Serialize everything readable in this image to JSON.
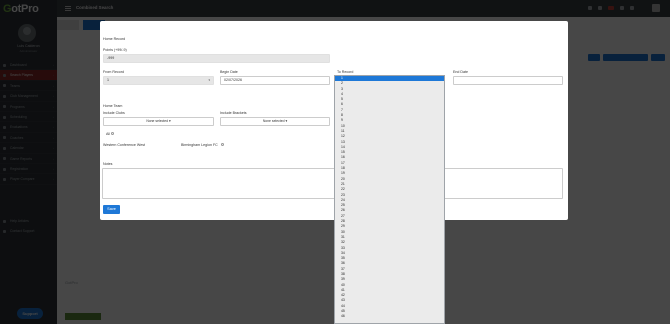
{
  "app": {
    "logo_prefix": "G",
    "logo_rest": "otPro",
    "user_name": "Luis Calderon",
    "user_role": "Administrator"
  },
  "topbar": {
    "title": "Combined Search"
  },
  "sidebar": {
    "items": [
      {
        "label": "Dashboard",
        "icon": "dashboard-icon"
      },
      {
        "label": "Search Players",
        "icon": "search-icon",
        "active": true
      },
      {
        "label": "Teams",
        "icon": "users-icon"
      },
      {
        "label": "Club Management",
        "icon": "building-icon"
      },
      {
        "label": "Programs",
        "icon": "list-icon"
      },
      {
        "label": "Scheduling",
        "icon": "calendar-icon"
      },
      {
        "label": "Evaluations",
        "icon": "clipboard-icon"
      },
      {
        "label": "Coaches",
        "icon": "whistle-icon"
      },
      {
        "label": "Calendar",
        "icon": "calendar-icon"
      },
      {
        "label": "Game Reports",
        "icon": "report-icon"
      },
      {
        "label": "Registration",
        "icon": "form-icon"
      },
      {
        "label": "Player Compare",
        "icon": "compare-icon"
      }
    ],
    "bottom_items": [
      {
        "label": "Help Articles",
        "icon": "help-icon"
      },
      {
        "label": "Contact Support",
        "icon": "mail-icon"
      }
    ],
    "support_label": "Support"
  },
  "background": {
    "footer_text": "GotPro"
  },
  "modal": {
    "section_title": "Home Record",
    "points_label": "Points (+99/-9)",
    "points_value": "-999",
    "from_record_label": "From Record",
    "from_record_value": "1",
    "begin_date_label": "Begin Date",
    "begin_date_value": "02/07/2026",
    "to_record_label": "To Record",
    "to_record_value": "1",
    "end_date_label": "End Date",
    "end_date_value": "",
    "home_team_label": "Home Team",
    "include_clubs_label": "Include Clubs",
    "include_clubs_value": "None selected",
    "include_brackets_label": "Include Brackets",
    "include_brackets_value": "None selected",
    "all_label": "All",
    "western_conf_label": "Western Conference West",
    "birmingham_label": "Birmingham Legion FC",
    "notes_label": "Notes",
    "save_label": "Save"
  },
  "dropdown": {
    "selected": "1",
    "options": [
      "1",
      "2",
      "3",
      "4",
      "5",
      "6",
      "7",
      "8",
      "9",
      "10",
      "11",
      "12",
      "13",
      "14",
      "15",
      "16",
      "17",
      "18",
      "19",
      "20",
      "21",
      "22",
      "23",
      "24",
      "25",
      "26",
      "27",
      "28",
      "29",
      "30",
      "31",
      "32",
      "33",
      "34",
      "35",
      "36",
      "37",
      "38",
      "39",
      "40",
      "41",
      "42",
      "43",
      "44",
      "45",
      "46"
    ]
  }
}
